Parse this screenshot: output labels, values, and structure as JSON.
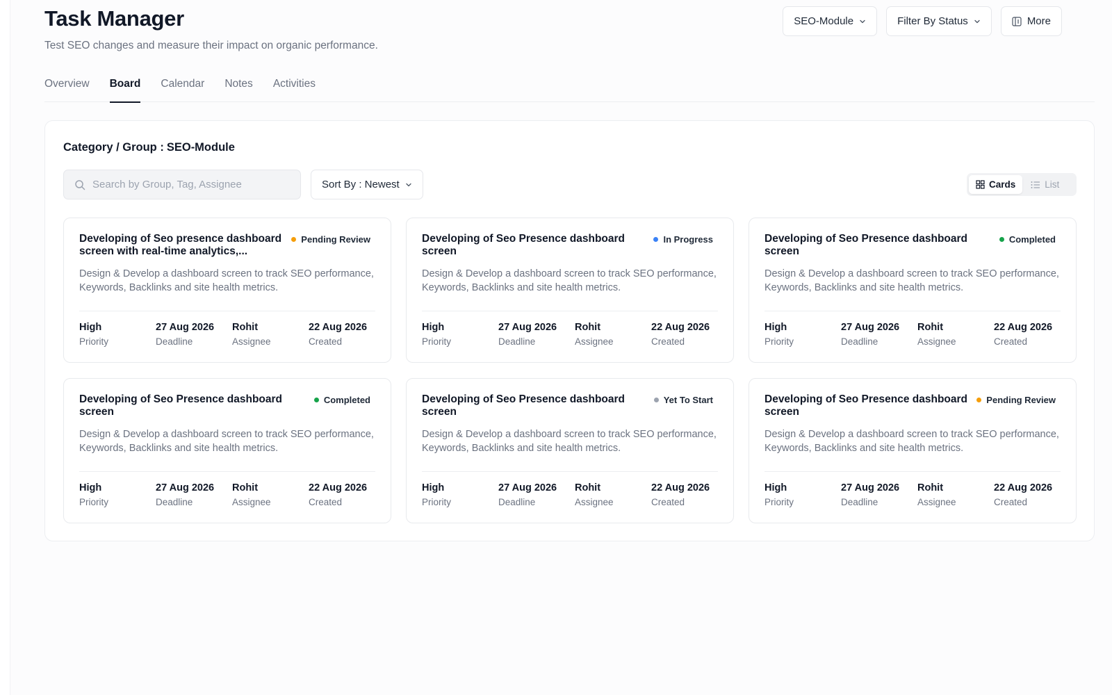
{
  "header": {
    "title": "Task Manager",
    "subtitle": "Test SEO changes and measure their impact on organic performance.",
    "module_select": "SEO-Module",
    "status_filter": "Filter By Status",
    "more_label": "More"
  },
  "tabs": [
    {
      "label": "Overview"
    },
    {
      "label": "Board"
    },
    {
      "label": "Calendar"
    },
    {
      "label": "Notes"
    },
    {
      "label": "Activities"
    }
  ],
  "active_tab": "Board",
  "panel": {
    "category_label": "Category / Group :",
    "category_value": "SEO-Module",
    "search_placeholder": "Search by Group, Tag, Assignee",
    "sort_label": "Sort By : Newest",
    "view_cards": "Cards",
    "view_list": "List"
  },
  "status_colors": {
    "Pending Review": "#f59e0b",
    "In Progress": "#3b82f6",
    "Completed": "#16a34a",
    "Yet To Start": "#9ca3af"
  },
  "cards": [
    {
      "title": "Developing of Seo presence dashboard screen with real-time analytics,...",
      "status": "Pending Review",
      "description": "Design & Develop a dashboard screen to track SEO performance, Keywords, Backlinks and site health metrics.",
      "priority": "High",
      "priority_label": "Priority",
      "deadline": "27 Aug 2026",
      "deadline_label": "Deadline",
      "assignee": "Rohit",
      "assignee_label": "Assignee",
      "created": "22 Aug 2026",
      "created_label": "Created"
    },
    {
      "title": "Developing of Seo Presence dashboard screen",
      "status": "In Progress",
      "description": "Design & Develop a dashboard screen to track SEO performance, Keywords, Backlinks and site health metrics.",
      "priority": "High",
      "priority_label": "Priority",
      "deadline": "27 Aug 2026",
      "deadline_label": "Deadline",
      "assignee": "Rohit",
      "assignee_label": "Assignee",
      "created": "22 Aug 2026",
      "created_label": "Created"
    },
    {
      "title": "Developing of Seo Presence dashboard screen",
      "status": "Completed",
      "description": "Design & Develop a dashboard screen to track SEO performance, Keywords, Backlinks and site health metrics.",
      "priority": "High",
      "priority_label": "Priority",
      "deadline": "27 Aug 2026",
      "deadline_label": "Deadline",
      "assignee": "Rohit",
      "assignee_label": "Assignee",
      "created": "22 Aug 2026",
      "created_label": "Created"
    },
    {
      "title": "Developing of Seo Presence dashboard screen",
      "status": "Completed",
      "description": "Design & Develop a dashboard screen to track SEO performance, Keywords, Backlinks and site health metrics.",
      "priority": "High",
      "priority_label": "Priority",
      "deadline": "27 Aug 2026",
      "deadline_label": "Deadline",
      "assignee": "Rohit",
      "assignee_label": "Assignee",
      "created": "22 Aug 2026",
      "created_label": "Created"
    },
    {
      "title": "Developing of Seo Presence dashboard screen",
      "status": "Yet To Start",
      "description": "Design & Develop a dashboard screen to track SEO performance, Keywords, Backlinks and site health metrics.",
      "priority": "High",
      "priority_label": "Priority",
      "deadline": "27 Aug 2026",
      "deadline_label": "Deadline",
      "assignee": "Rohit",
      "assignee_label": "Assignee",
      "created": "22 Aug 2026",
      "created_label": "Created"
    },
    {
      "title": "Developing of Seo Presence dashboard screen",
      "status": "Pending Review",
      "description": "Design & Develop a dashboard screen to track SEO performance, Keywords, Backlinks and site health metrics.",
      "priority": "High",
      "priority_label": "Priority",
      "deadline": "27 Aug 2026",
      "deadline_label": "Deadline",
      "assignee": "Rohit",
      "assignee_label": "Assignee",
      "created": "22 Aug 2026",
      "created_label": "Created"
    }
  ],
  "icons": {
    "search": "search-icon",
    "chevron": "chevron-down-icon",
    "more": "columns-icon",
    "cards": "grid-icon",
    "list": "list-icon"
  }
}
